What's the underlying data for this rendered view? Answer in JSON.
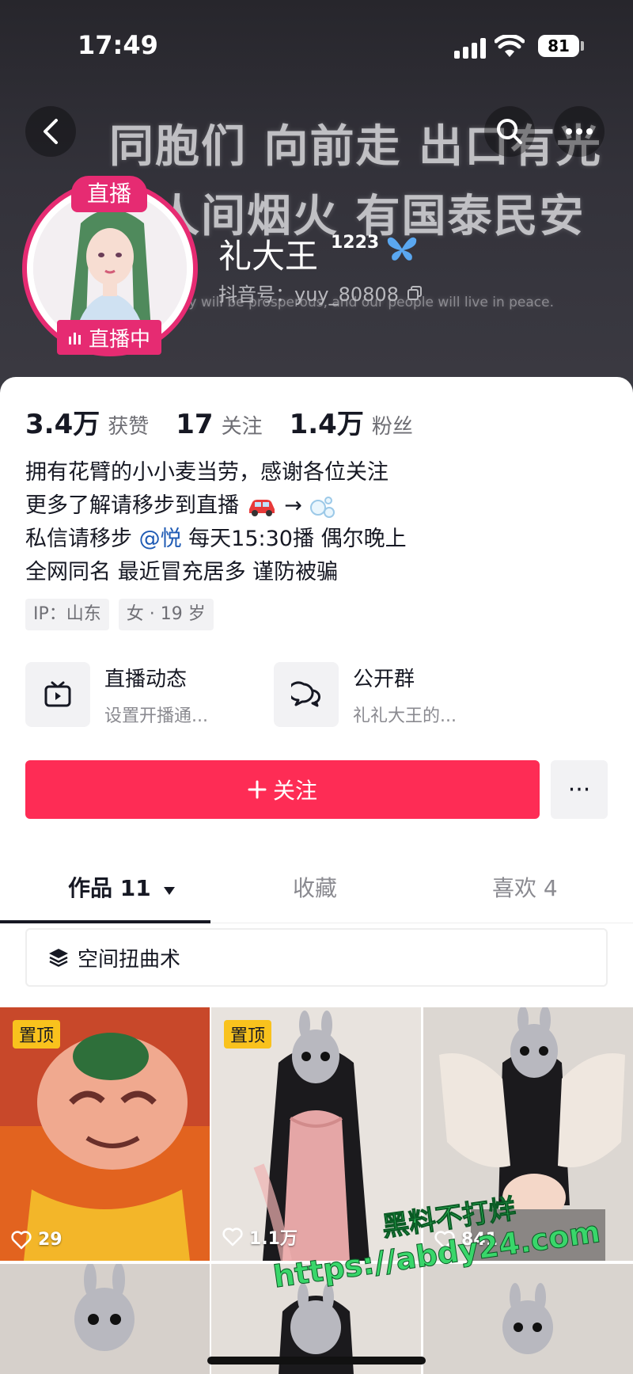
{
  "status_bar": {
    "time": "17:49",
    "battery": "81"
  },
  "banner": {
    "line1": "同胞们 向前走 出口有光",
    "line2": "人间烟火 有国泰民安",
    "english": "ntry will be prosperous, and our people will live in peace."
  },
  "profile": {
    "live_top": "直播",
    "live_bottom": "直播中",
    "name": "礼大王",
    "badge": "1223",
    "douyin_id": "抖音号：yuy_80808"
  },
  "stats": [
    {
      "num": "3.4万",
      "label": "获赞"
    },
    {
      "num": "17",
      "label": "关注"
    },
    {
      "num": "1.4万",
      "label": "粉丝"
    }
  ],
  "bio": {
    "line1": "拥有花臂的小小麦当劳，感谢各位关注",
    "line2_prefix": "更多了解请移步到直播",
    "line2_arrow": "→",
    "line3_prefix": "私信请移步 ",
    "line3_mention": "@悦",
    "line3_suffix": " 每天15:30播 偶尔晚上",
    "line4": "全网同名 最近冒充居多 谨防被骗"
  },
  "tags": [
    "IP：山东",
    "女 · 19 岁"
  ],
  "quick_entries": [
    {
      "title": "直播动态",
      "sub": "设置开播通..."
    },
    {
      "title": "公开群",
      "sub": "礼礼大王的..."
    }
  ],
  "actions": {
    "follow": "关注",
    "more": "···"
  },
  "tabs": [
    {
      "label": "作品 11"
    },
    {
      "label": "收藏"
    },
    {
      "label": "喜欢 4"
    }
  ],
  "collection": {
    "label": "空间扭曲术"
  },
  "videos": [
    {
      "pinned": "置顶",
      "likes": "29"
    },
    {
      "pinned": "置顶",
      "likes": "1.1万"
    },
    {
      "pinned": "",
      "likes": "841"
    }
  ],
  "watermark": {
    "line1": "黑料不打烊",
    "line2": "https://abdy24.com"
  },
  "colors": {
    "accent": "#fe2c55",
    "live": "#e62b72",
    "pin": "#f9c21d",
    "mention": "#1f5bb4"
  }
}
